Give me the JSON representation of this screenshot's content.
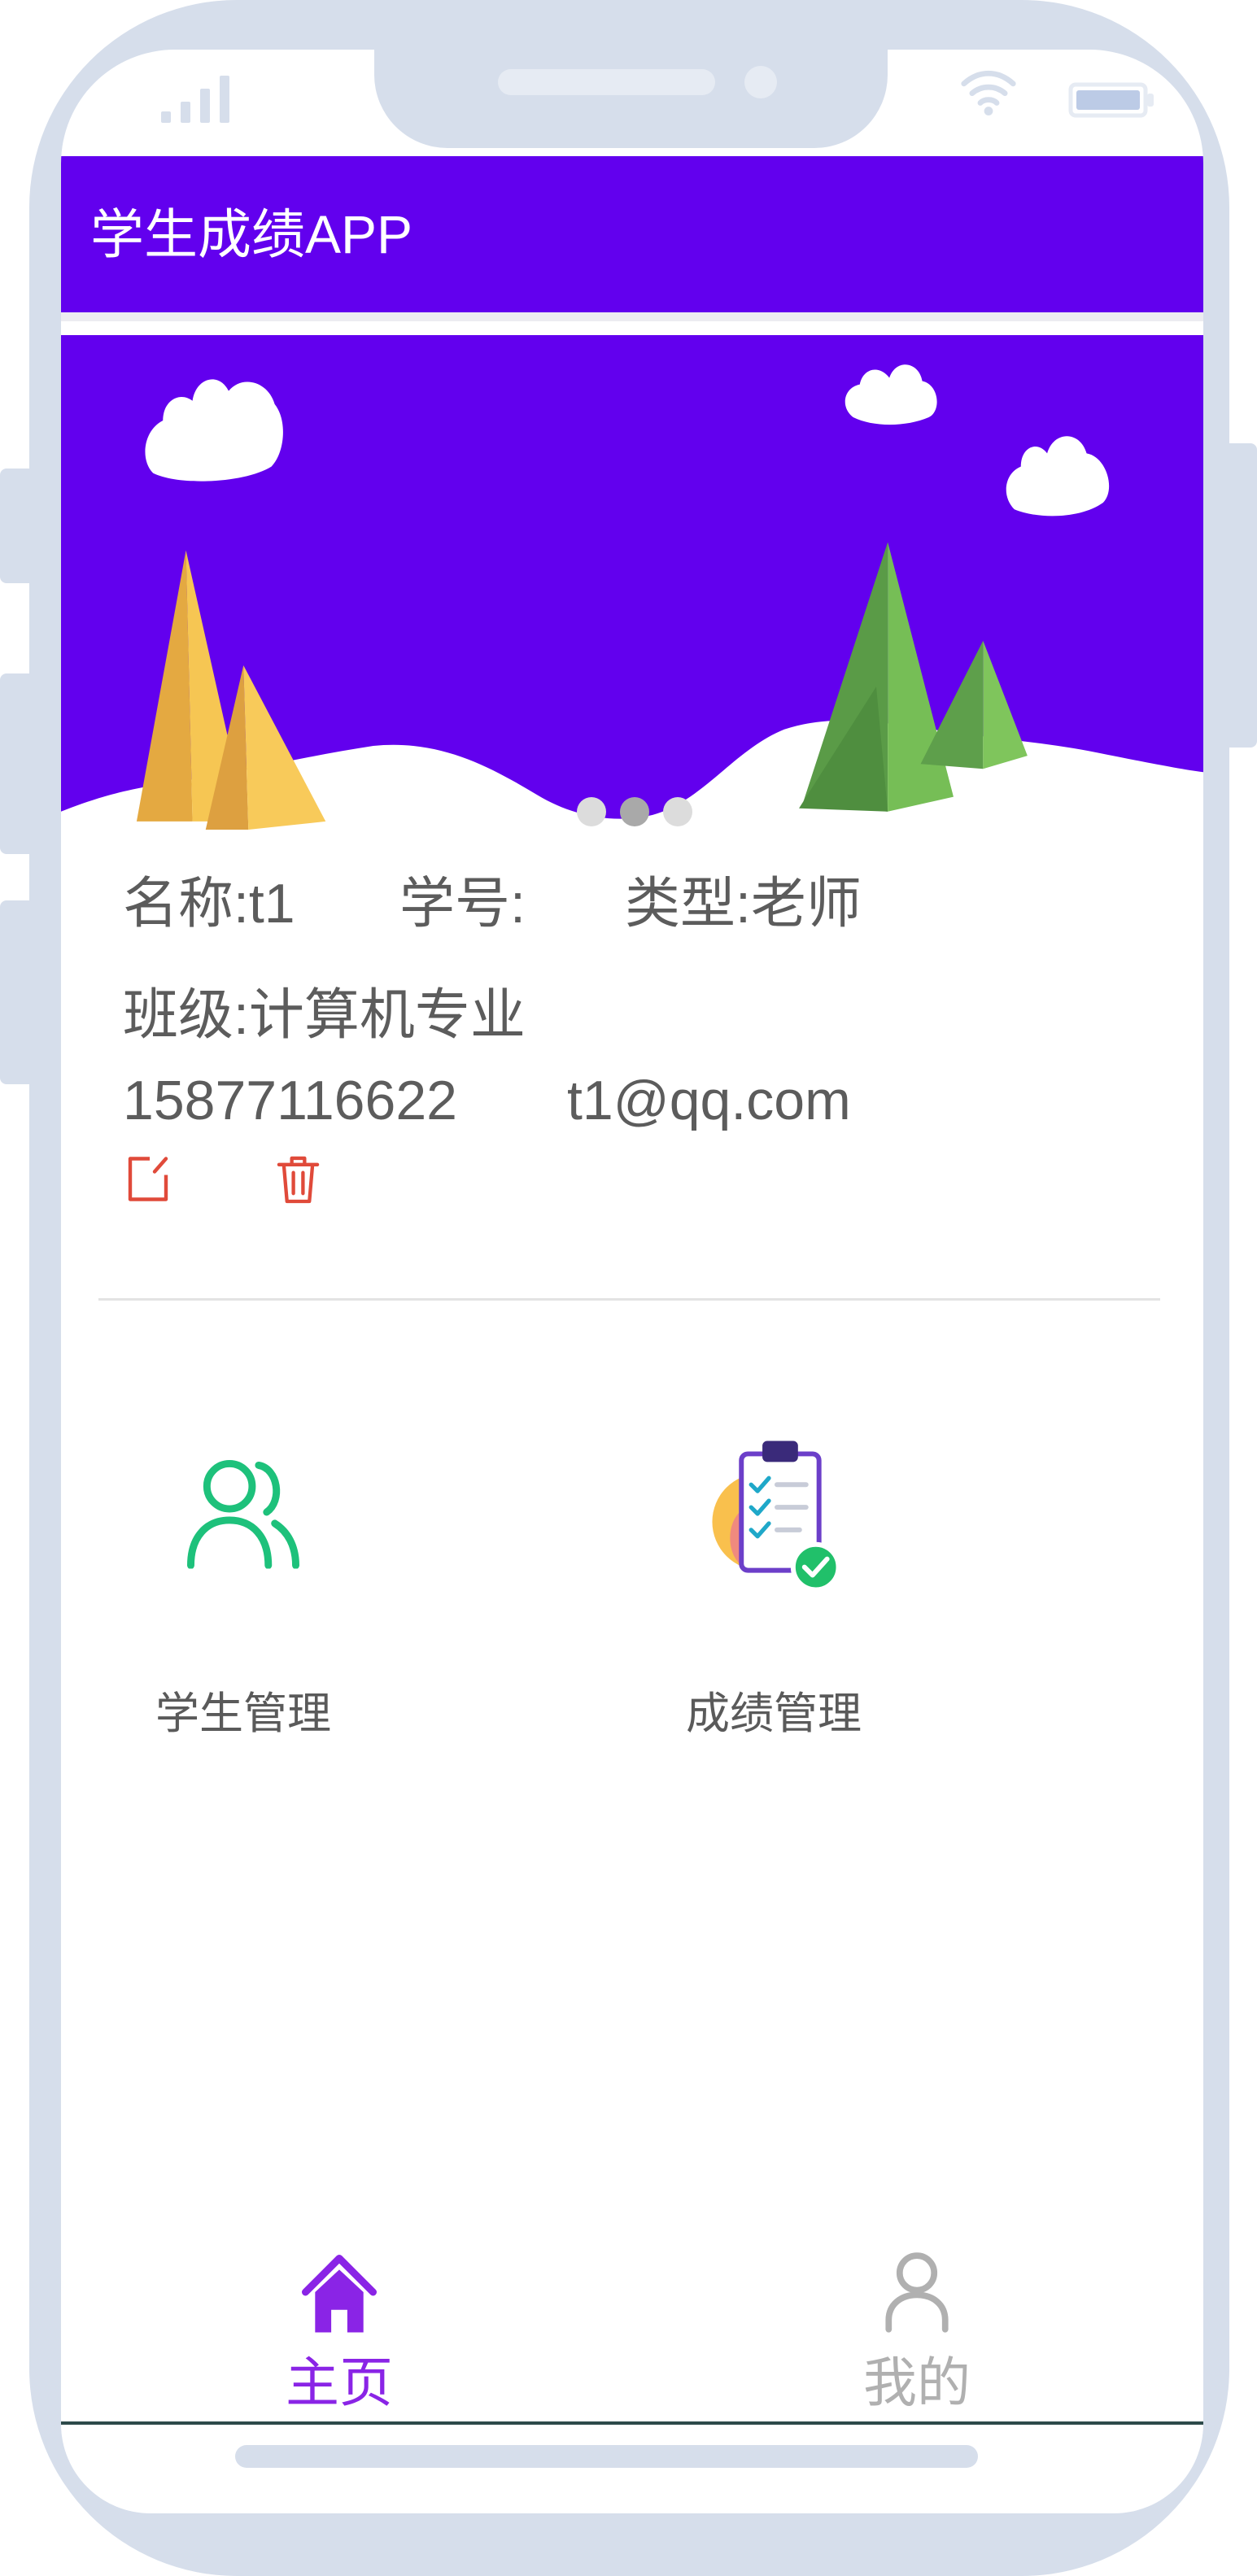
{
  "status_bar": {
    "signal_icon": "signal-icon",
    "wifi_icon": "wifi-icon",
    "battery_icon": "battery-icon"
  },
  "app_bar": {
    "title": "学生成绩APP"
  },
  "banner": {
    "dot_count": 3,
    "active_dot": 1
  },
  "profile": {
    "name": {
      "label": "名称:",
      "value": "t1"
    },
    "student_id": {
      "label": "学号:"
    },
    "type": {
      "label": "类型:",
      "value": "老师"
    },
    "class": {
      "label": "班级:",
      "value": "计算机专业"
    },
    "phone": "15877116622",
    "email": "t1@qq.com",
    "actions": {
      "edit_icon": "edit-icon",
      "delete_icon": "trash-icon"
    }
  },
  "menu": [
    {
      "label": "学生管理",
      "icon": "users-icon"
    },
    {
      "label": "成绩管理",
      "icon": "clipboard-check-icon"
    }
  ],
  "bottom_nav": [
    {
      "label": "主页",
      "icon": "home-icon",
      "active": true
    },
    {
      "label": "我的",
      "icon": "person-icon",
      "active": false
    }
  ],
  "colors": {
    "primary": "#6200EE",
    "frame": "#D6DEEB",
    "nav_active": "#8A24E6",
    "nav_inactive": "#B0B0B0",
    "danger": "#E04A3A",
    "accent_green": "#1EC17B"
  }
}
